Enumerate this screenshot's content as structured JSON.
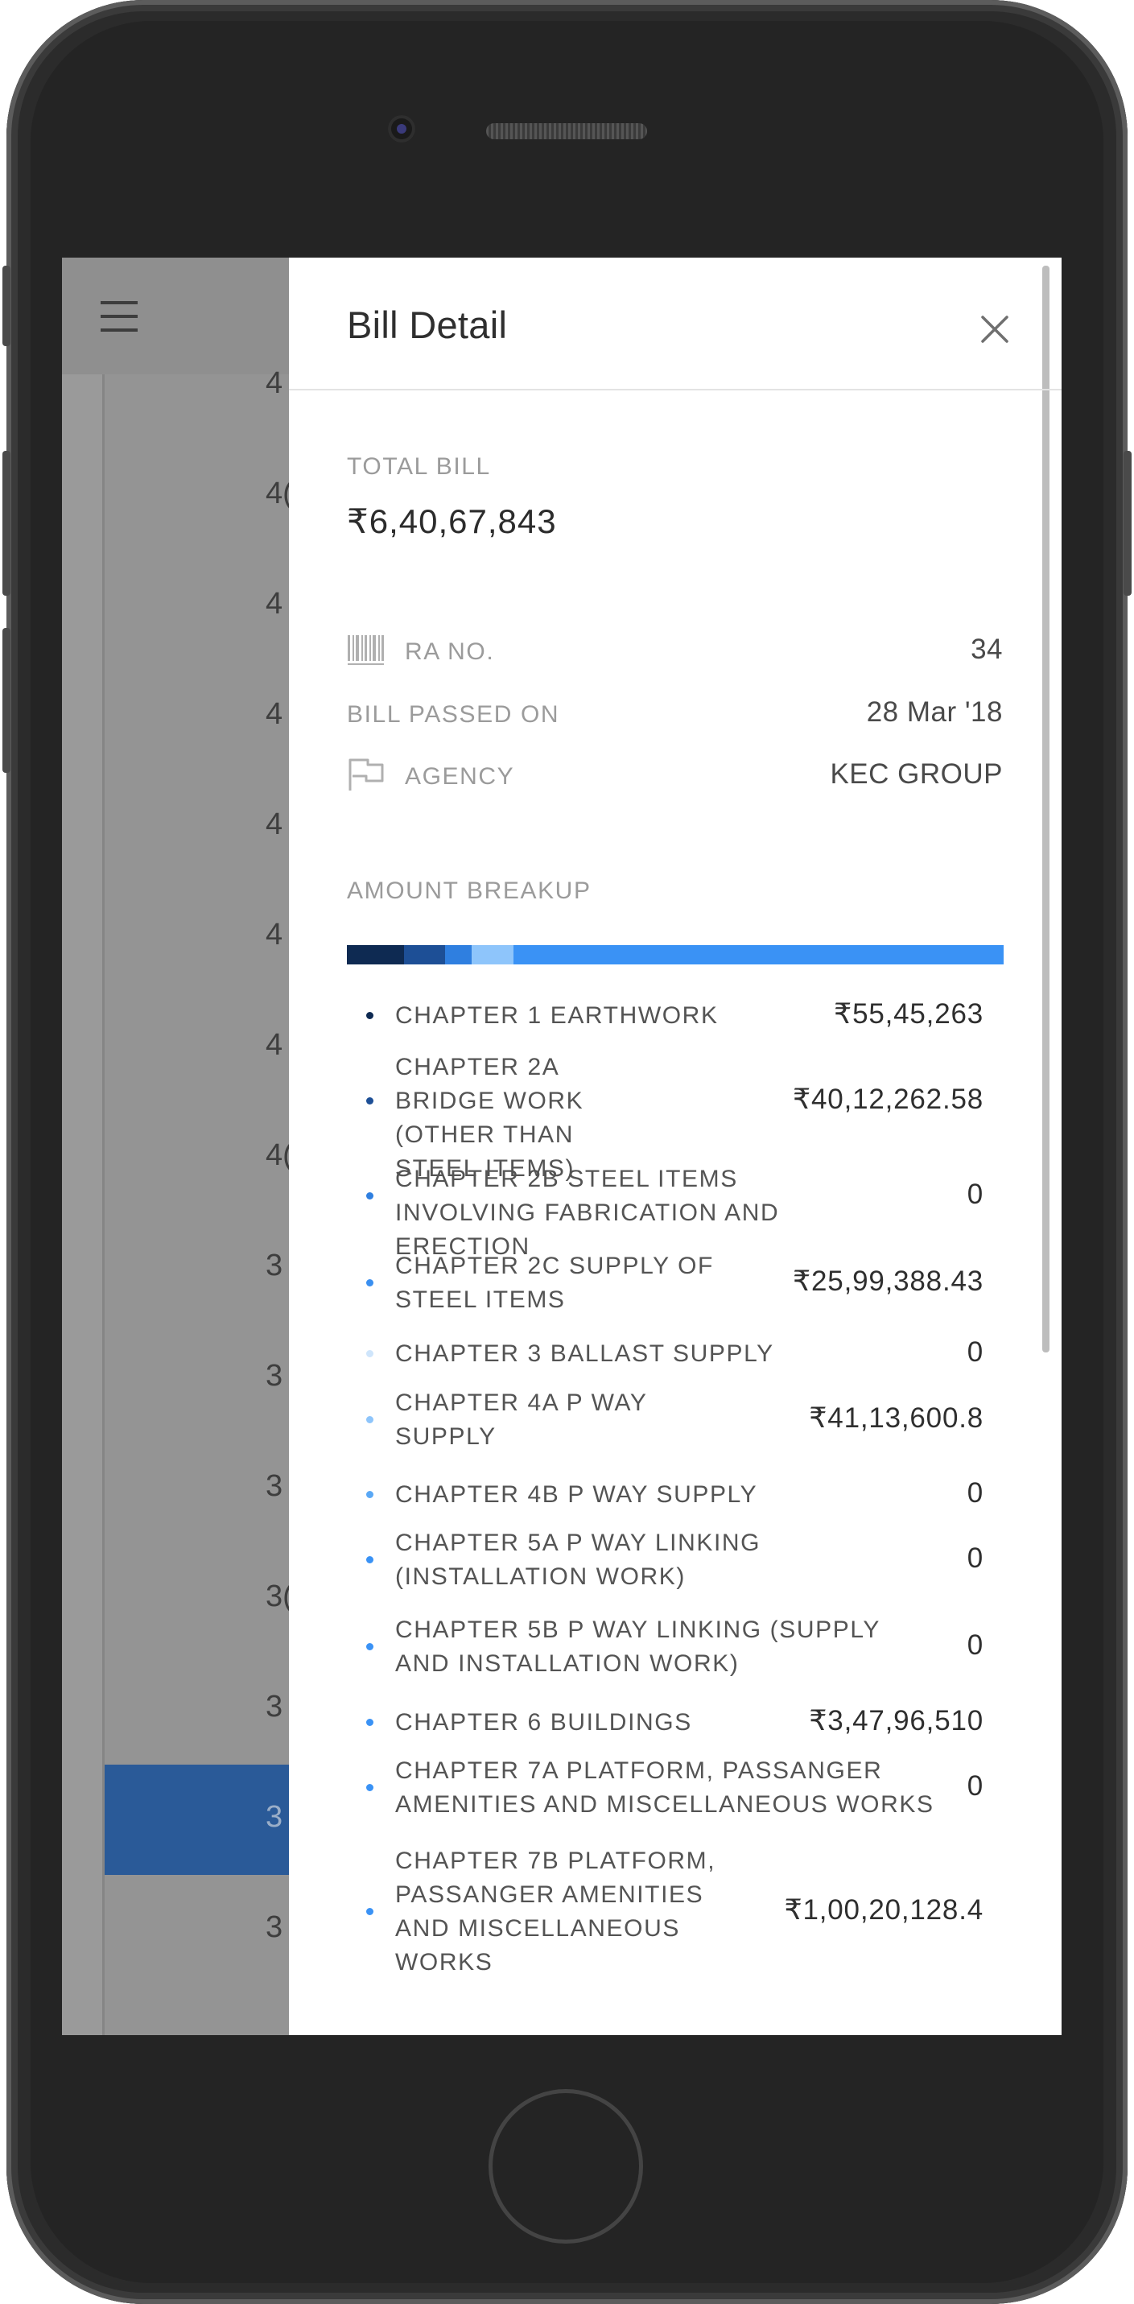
{
  "background_list": {
    "numbers": [
      "4",
      "4(",
      "4",
      "4",
      "4",
      "4",
      "4",
      "4(",
      "3",
      "3",
      "3",
      "3(",
      "3",
      "3",
      "3"
    ]
  },
  "drawer": {
    "title": "Bill Detail",
    "close_icon": "close-x-icon",
    "total_bill": {
      "label": "TOTAL BILL",
      "value": "₹6,40,67,843"
    },
    "info": [
      {
        "icon": "barcode-icon",
        "label": "RA NO.",
        "value": "34"
      },
      {
        "icon": "",
        "label": "BILL PASSED ON",
        "value": "28 Mar '18"
      },
      {
        "icon": "flag-icon",
        "label": "AGENCY",
        "value": "KEC GROUP"
      }
    ],
    "amount_breakup": {
      "label": "AMOUNT BREAKUP",
      "bar_segments": [
        {
          "color": "#0e2a52",
          "share": 0.0865
        },
        {
          "color": "#1d4f96",
          "share": 0.0626
        },
        {
          "color": "#2f7fe0",
          "share": 0.0406
        },
        {
          "color": "#8ec5fb",
          "share": 0.0642
        },
        {
          "color": "#3a92f5",
          "share": 0.7461
        }
      ],
      "items": [
        {
          "name": "CHAPTER 1 EARTHWORK",
          "amount": "₹55,45,263",
          "color": "#0e2a52"
        },
        {
          "name": "CHAPTER 2A BRIDGE WORK (OTHER THAN STEEL ITEMS)",
          "amount": "₹40,12,262.58",
          "color": "#1d4f96"
        },
        {
          "name": "CHAPTER 2B STEEL ITEMS INVOLVING FABRICATION AND ERECTION",
          "amount": "0",
          "color": "#2f7fe0"
        },
        {
          "name": "CHAPTER 2C SUPPLY OF STEEL ITEMS",
          "amount": "₹25,99,388.43",
          "color": "#3a8ff0"
        },
        {
          "name": "CHAPTER 3 BALLAST SUPPLY",
          "amount": "0",
          "color": "#cfe5fb"
        },
        {
          "name": "CHAPTER 4A P WAY SUPPLY",
          "amount": "₹41,13,600.8",
          "color": "#8ec5fb"
        },
        {
          "name": "CHAPTER 4B P WAY SUPPLY",
          "amount": "0",
          "color": "#5aa8f5"
        },
        {
          "name": "CHAPTER 5A P WAY LINKING (INSTALLATION WORK)",
          "amount": "0",
          "color": "#3a92f5"
        },
        {
          "name": "CHAPTER 5B P WAY LINKING (SUPPLY AND INSTALLATION WORK)",
          "amount": "0",
          "color": "#3a92f5"
        },
        {
          "name": "CHAPTER 6 BUILDINGS",
          "amount": "₹3,47,96,510",
          "color": "#3a92f5"
        },
        {
          "name": "CHAPTER 7A PLATFORM, PASSANGER AMENITIES AND MISCELLANEOUS WORKS",
          "amount": "0",
          "color": "#3a92f5"
        },
        {
          "name": "CHAPTER 7B PLATFORM, PASSANGER AMENITIES AND MISCELLANEOUS WORKS",
          "amount": "₹1,00,20,128.4",
          "color": "#3a92f5"
        }
      ]
    }
  }
}
